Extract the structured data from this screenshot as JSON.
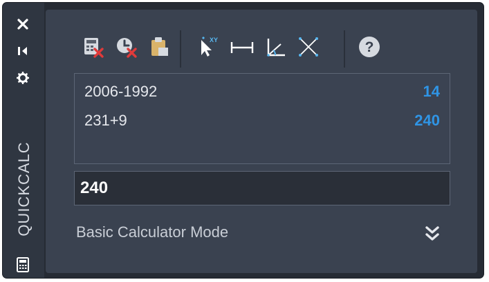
{
  "palette": {
    "window_bg": "#262b34",
    "rail_bg": "#2f3641",
    "panel_bg": "#3a4250",
    "history_bg": "#3b4352",
    "input_bg": "#2a2f38",
    "border": "#5d6676",
    "text": "#e6e8ed",
    "accent_blue": "#2f95e6",
    "delete_red": "#e03a3a",
    "paste_tan": "#d9b36a",
    "toolbar_blue": "#58b7f0"
  },
  "rail": {
    "title": "QUICKCALC",
    "icons": [
      "close-icon",
      "pin-icon",
      "settings-icon",
      "calculator-icon"
    ]
  },
  "toolbar": {
    "icons": [
      "clear-icon",
      "clear-history-icon",
      "paste-icon",
      "get-coordinates-icon",
      "distance-icon",
      "angle-icon",
      "intersection-icon",
      "help-icon"
    ],
    "help_glyph": "?",
    "coord_label": "XY"
  },
  "history": [
    {
      "expression": "2006-1992",
      "result": "14"
    },
    {
      "expression": "231+9",
      "result": "240"
    }
  ],
  "input": {
    "value": "240"
  },
  "mode": {
    "label": "Basic Calculator Mode",
    "expand_icon": "double-chevron-down-icon"
  }
}
